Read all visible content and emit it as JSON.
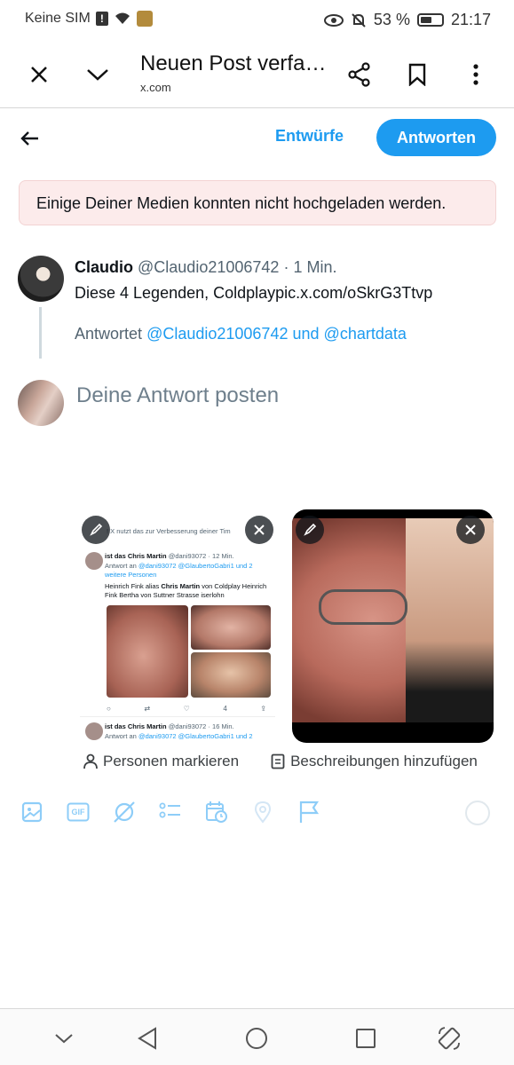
{
  "status_bar": {
    "carrier": "Keine SIM",
    "battery_percent": "53 %",
    "battery_level": 0.53,
    "time": "21:17"
  },
  "browser": {
    "title": "Neuen Post verfa…",
    "url": "x.com"
  },
  "compose": {
    "drafts_label": "Entwürfe",
    "reply_label": "Antworten",
    "error_message": "Einige Deiner Medien konnten nicht hochgeladen werden."
  },
  "original_post": {
    "name": "Claudio",
    "handle": "@Claudio21006742",
    "separator": "·",
    "time": "1 Min.",
    "text": "Diese 4 Legenden, Coldplaypic.x.com/oSkrG3Ttvp",
    "replying_prefix": "Antwortet",
    "mention_1": "@Claudio21006742",
    "replying_and": "und",
    "mention_2": "@chartdata"
  },
  "reply": {
    "placeholder": "Deine Antwort posten"
  },
  "media_screenshot": {
    "note": "! X nutzt das zur Verbesserung deiner Tim",
    "post1_name": "ist das Chris Martin",
    "post1_handle": "@dani93072 · 12 Min.",
    "post1_reply_prefix": "Antwort an",
    "post1_reply_mentions": "@dani93072 @GlaubertoGabri1 und 2",
    "post1_reply_more": "weitere Personen",
    "post1_text_1": "Heinrich Fink alias",
    "post1_text_bold": "Chris Martin",
    "post1_text_2": "von Coldplay Heinrich",
    "post1_text_3": "Fink Bertha von Suttner Strasse iserlohn",
    "post1_views": "4",
    "post2_name": "ist das Chris Martin",
    "post2_handle": "@dani93072 · 16 Min.",
    "post2_reply_prefix": "Antwort an",
    "post2_reply_mentions": "@dani93072 @GlaubertoGabri1 und 2"
  },
  "media_actions": {
    "tag_people": "Personen markieren",
    "add_descriptions": "Beschreibungen hinzufügen"
  },
  "toolbar": {
    "gif_label": "GIF"
  },
  "colors": {
    "accent": "#1d9bf0",
    "error_bg": "#fcebeb",
    "text": "#0f1419",
    "muted": "#536471"
  },
  "icons": [
    "close-icon",
    "chevron-down-icon",
    "share-icon",
    "bookmark-icon",
    "more-vert-icon",
    "back-arrow-icon",
    "edit-icon",
    "media-close-icon",
    "person-icon",
    "description-icon",
    "image-icon",
    "gif-icon",
    "grok-icon",
    "poll-icon",
    "schedule-icon",
    "location-icon",
    "flag-icon",
    "nav-hide-icon",
    "nav-back-icon",
    "nav-home-icon",
    "nav-recents-icon",
    "rotate-icon"
  ]
}
